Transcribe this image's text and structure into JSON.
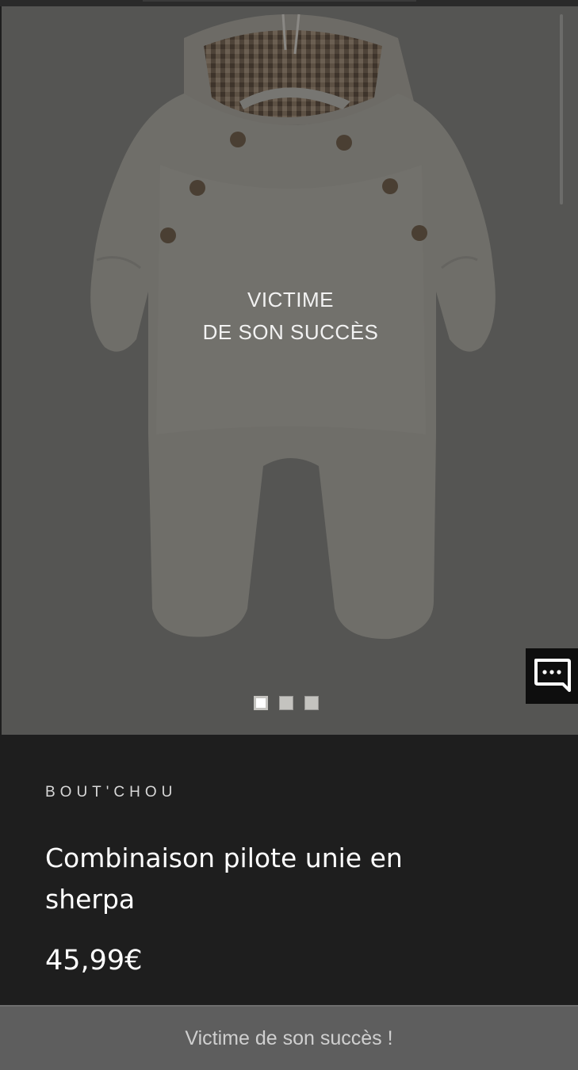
{
  "product": {
    "overlay_line1": "VICTIME",
    "overlay_line2": "DE SON SUCCÈS",
    "image_alt": "Combinaison pilote unie en sherpa",
    "carousel": {
      "dots": [
        "slide-1",
        "slide-2",
        "slide-3"
      ],
      "active_index": 0
    },
    "brand": "BOUT'CHOU",
    "title": "Combinaison pilote unie en sherpa",
    "price": "45,99€"
  },
  "chat": {
    "icon": "chat-bubble-icon"
  },
  "cta": {
    "label": "Victime de son succès !"
  },
  "colors": {
    "background": "#1e1e1e",
    "image_overlay": "#555553",
    "button": "#5e5e5e",
    "text": "#ffffff"
  }
}
